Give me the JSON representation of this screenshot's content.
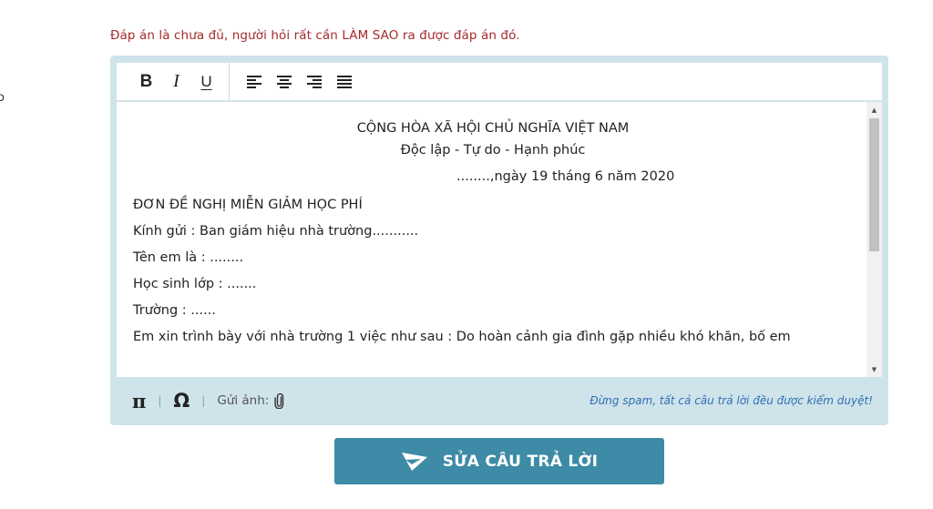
{
  "left_stub": "o",
  "hint": "Đáp án là chưa đủ, người hỏi rất cần LÀM SAO ra được đáp án đó.",
  "toolbar": {
    "bold": "B",
    "italic": "I",
    "underline": "U",
    "align_icons": [
      "align-left-icon",
      "align-center-icon",
      "align-right-icon",
      "align-justify-icon"
    ]
  },
  "document": {
    "header_line1": "CỘNG HÒA XÃ HỘI CHỦ NGHĨA VIỆT NAM",
    "header_line2": "Độc lập - Tự do - Hạnh phúc",
    "date": "........,ngày 19 tháng 6 năm 2020",
    "lines": [
      "ĐƠN ĐỀ NGHỊ MIỄN GIẢM HỌC PHÍ",
      "Kính gửi : Ban giám hiệu nhà trường...........",
      "Tên em là : ........",
      "Học sinh lớp : .......",
      "Trường : ......",
      "Em xin trình bày với nhà trường 1 việc như sau : Do hoàn  cảnh gia đình gặp nhiều khó khăn, bố em"
    ]
  },
  "footer": {
    "pi": "π",
    "omega": "Ω",
    "separator": "|",
    "send_image": "Gửi ảnh:",
    "notice": "Đừng spam, tất cả câu trả lời đều được kiểm duyệt!"
  },
  "submit_label": "SỬA CÂU TRẢ LỜI",
  "colors": {
    "hint": "#a52a2a",
    "editor_bg": "#cfe3ea",
    "notice": "#2f6fb3",
    "submit_bg": "#3d8ba6"
  }
}
